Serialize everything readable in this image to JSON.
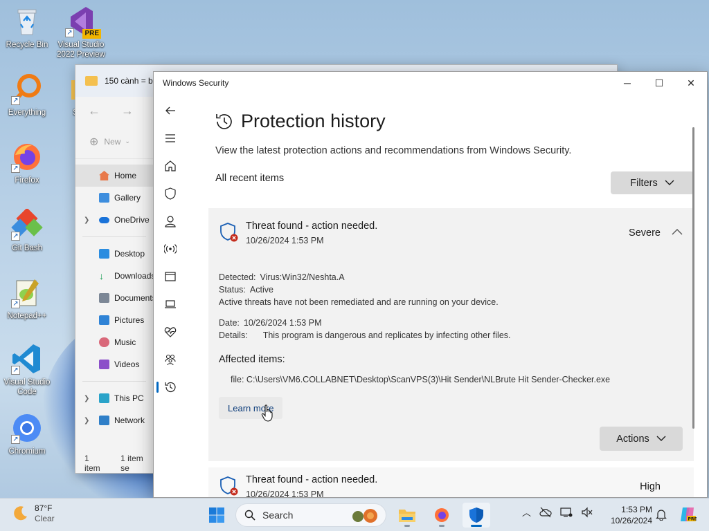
{
  "desktop": {
    "icons": [
      {
        "label": "Recycle Bin",
        "icon": "recycle-bin-icon"
      },
      {
        "label": "Visual Studio 2022 Preview",
        "icon": "visual-studio-icon",
        "badge": "PRE"
      },
      {
        "label": "Everything",
        "icon": "everything-search-icon"
      },
      {
        "label": "Firefox",
        "icon": "firefox-icon"
      },
      {
        "label": "Git Bash",
        "icon": "git-bash-icon"
      },
      {
        "label": "Notepad++",
        "icon": "notepadpp-icon"
      },
      {
        "label": "Visual Studio Code",
        "icon": "vscode-icon"
      },
      {
        "label": "Chromium",
        "icon": "chromium-icon"
      },
      {
        "label": "Sca",
        "icon": "folder-icon"
      }
    ]
  },
  "explorer": {
    "title": "150 cành = b",
    "new_label": "New",
    "nav": [
      {
        "label": "Home",
        "selected": true
      },
      {
        "label": "Gallery"
      },
      {
        "label": "OneDrive",
        "expandable": true
      },
      {
        "label": "Desktop"
      },
      {
        "label": "Downloads"
      },
      {
        "label": "Documents"
      },
      {
        "label": "Pictures"
      },
      {
        "label": "Music"
      },
      {
        "label": "Videos"
      },
      {
        "label": "This PC",
        "expandable": true
      },
      {
        "label": "Network",
        "expandable": true
      }
    ],
    "status_items": "1 item",
    "status_selected": "1 item se"
  },
  "security": {
    "window_title": "Windows Security",
    "page_title": "Protection history",
    "description": "View the latest protection actions and recommendations from Windows Security.",
    "recent_label": "All recent items",
    "filters_label": "Filters",
    "threat1": {
      "title": "Threat found - action needed.",
      "date": "10/26/2024 1:53 PM",
      "severity": "Severe",
      "detected_label": "Detected:",
      "detected_value": "Virus:Win32/Neshta.A",
      "status_label": "Status:",
      "status_value": "Active",
      "status_note": "Active threats have not been remediated and are running on your device.",
      "date_label": "Date:",
      "date_value": "10/26/2024 1:53 PM",
      "details_label": "Details:",
      "details_value": "This program is dangerous and replicates by infecting other files.",
      "affected_heading": "Affected items:",
      "affected_file": "file: C:\\Users\\VM6.COLLABNET\\Desktop\\ScanVPS(3)\\Hit Sender\\NLBrute Hit Sender-Checker.exe",
      "learn_more": "Learn more",
      "actions_label": "Actions"
    },
    "threat2": {
      "title": "Threat found - action needed.",
      "date": "10/26/2024 1:53 PM",
      "severity": "High"
    }
  },
  "taskbar": {
    "temperature": "87°F",
    "condition": "Clear",
    "search_placeholder": "Search",
    "time": "1:53 PM",
    "date": "10/26/2024"
  },
  "colors": {
    "accent": "#0067c0",
    "threat_red": "#c42b1c",
    "shield_blue": "#1a5fb4"
  }
}
